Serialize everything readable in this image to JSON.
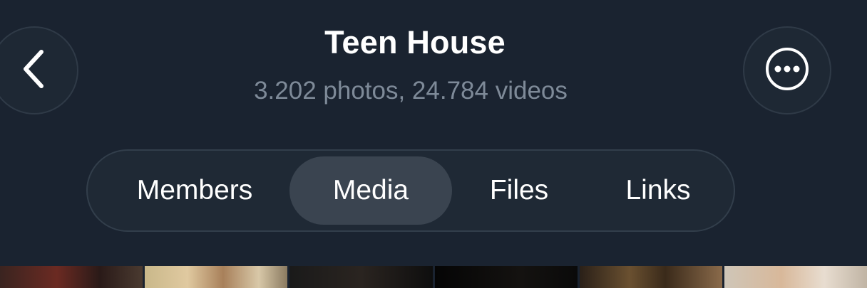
{
  "header": {
    "title": "Teen House",
    "subtitle": "3.202 photos, 24.784 videos",
    "back_icon": "chevron-left-icon",
    "more_icon": "ellipsis-circle-icon"
  },
  "tabs": [
    {
      "label": "Members",
      "selected": false
    },
    {
      "label": "Media",
      "selected": true
    },
    {
      "label": "Files",
      "selected": false
    },
    {
      "label": "Links",
      "selected": false
    }
  ],
  "colors": {
    "background": "#1a2330",
    "subtitle": "#7e8a98",
    "selected_tab": "#3a4450"
  }
}
